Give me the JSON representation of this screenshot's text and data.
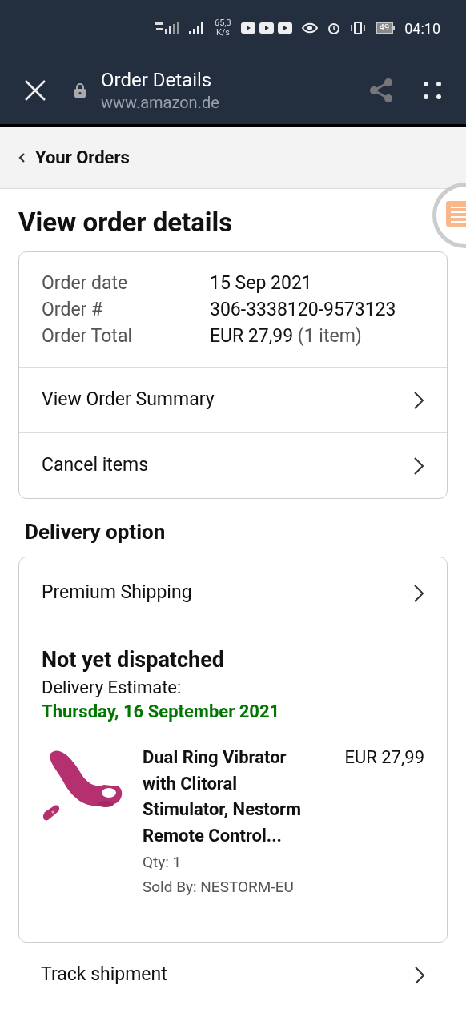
{
  "status_bar": {
    "speed": "65,3",
    "speed_unit": "K/s",
    "battery": "49",
    "time": "04:10"
  },
  "browser_bar": {
    "title": "Order Details",
    "url": "www.amazon.de"
  },
  "breadcrumb": "Your Orders",
  "page_title": "View order details",
  "order_info": [
    {
      "label": "Order date",
      "value": "15 Sep 2021"
    },
    {
      "label": "Order #",
      "value": "306-3338120-9573123"
    },
    {
      "label": "Order Total",
      "value": "EUR 27,99",
      "note": "(1 item)"
    }
  ],
  "order_links": [
    "View Order Summary",
    "Cancel items"
  ],
  "delivery": {
    "heading": "Delivery option",
    "option": "Premium Shipping",
    "status": "Not yet dispatched",
    "estimate_label": "Delivery Estimate:",
    "estimate_date": "Thursday, 16 September 2021",
    "item": {
      "title": "Dual Ring Vibrator with Clitoral Stimulator, Nestorm Remote Control...",
      "price": "EUR 27,99",
      "qty": "Qty: 1",
      "seller": "Sold By: NESTORM-EU"
    }
  },
  "bottom_link": "Track shipment"
}
